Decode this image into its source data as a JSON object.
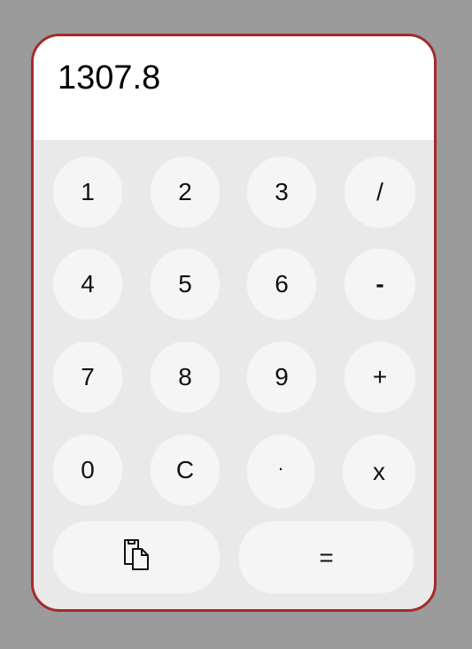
{
  "display": {
    "value": "1307.8"
  },
  "keys": {
    "k1": "1",
    "k2": "2",
    "k3": "3",
    "divide": "/",
    "k4": "4",
    "k5": "5",
    "k6": "6",
    "minus": "-",
    "k7": "7",
    "k8": "8",
    "k9": "9",
    "plus": "+",
    "k0": "0",
    "clear": "C",
    "decimal": "·",
    "multiply": "x",
    "copy_icon": "copy-icon",
    "equals": "="
  },
  "colors": {
    "frame_border": "#a52a2a",
    "background": "#9b9b9b",
    "keypad": "#e9e9e9",
    "key": "#f5f5f5",
    "display": "#ffffff"
  }
}
